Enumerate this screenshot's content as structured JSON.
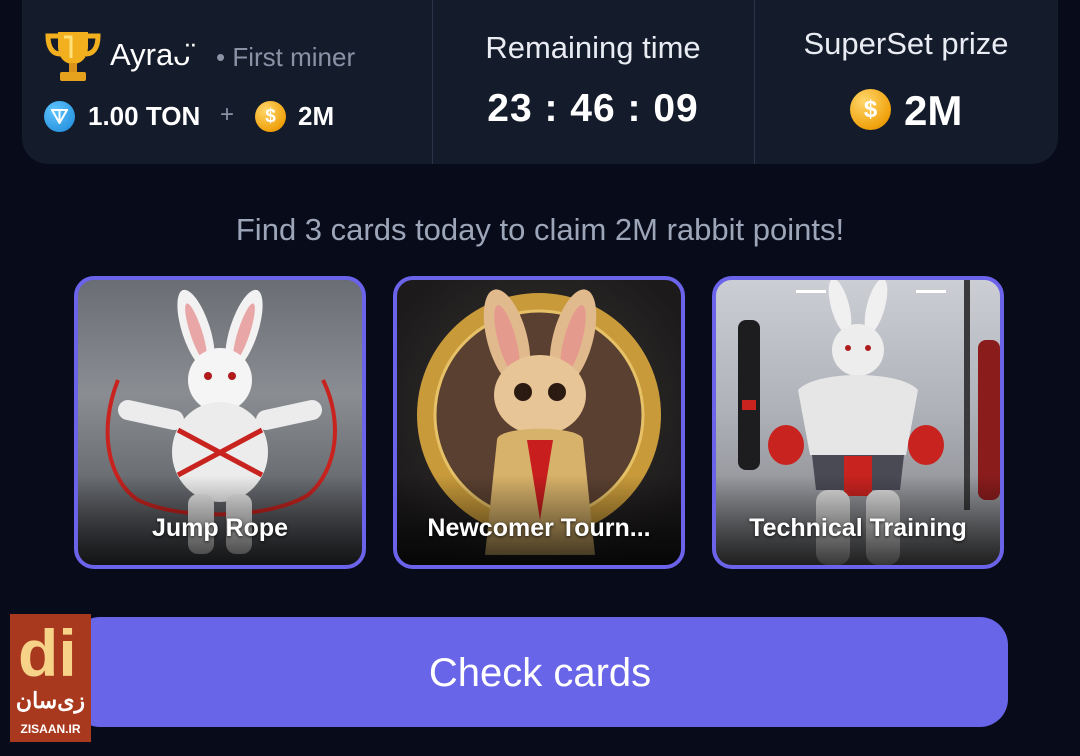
{
  "header": {
    "miner": {
      "name": "Ayraᴗ̈",
      "subtitle": "• First miner",
      "ton_amount": "1.00 TON",
      "plus": "+",
      "coin_amount": "2M"
    },
    "timer": {
      "label": "Remaining time",
      "value": "23 : 46 : 09"
    },
    "prize": {
      "label": "SuperSet prize",
      "amount": "2M"
    }
  },
  "find_text": "Find 3 cards today to claim 2M rabbit points!",
  "cards": [
    {
      "title": "Jump Rope"
    },
    {
      "title": "Newcomer Tourn..."
    },
    {
      "title": "Technical Training"
    }
  ],
  "check_button_label": "Check cards",
  "coin_symbol": "$",
  "watermark": {
    "mark": "di",
    "fa": "زی‌سان",
    "url": "ZISAAN.IR"
  },
  "colors": {
    "background": "#080b1a",
    "panel": "#141b2b",
    "accent": "#6865e8",
    "card_border": "#6b63ea",
    "coin": "#f0a20d"
  }
}
